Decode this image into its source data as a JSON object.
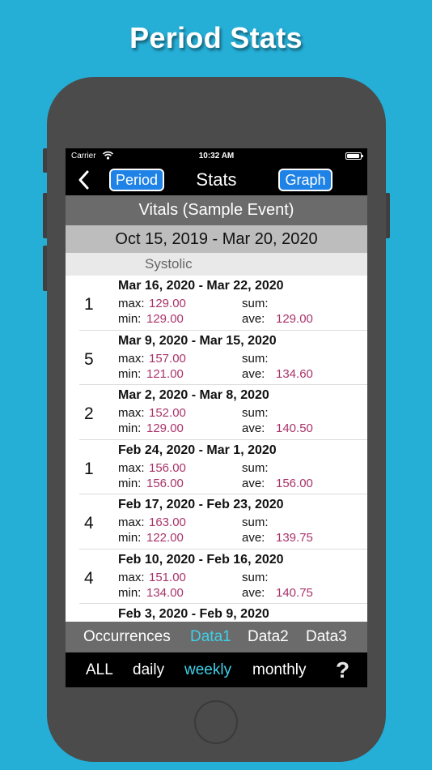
{
  "promo": {
    "title": "Period Stats"
  },
  "status_bar": {
    "carrier": "Carrier",
    "time": "10:32 AM"
  },
  "nav": {
    "period_label": "Period",
    "title": "Stats",
    "graph_label": "Graph"
  },
  "event_title": "Vitals (Sample Event)",
  "date_range": "Oct 15, 2019 - Mar 20, 2020",
  "section": "Systolic",
  "field_labels": {
    "max": "max:",
    "min": "min:",
    "sum": "sum:",
    "ave": "ave:"
  },
  "rows": [
    {
      "count": "1",
      "range": "Mar 16, 2020 - Mar 22, 2020",
      "max": "129.00",
      "min": "129.00",
      "ave": "129.00"
    },
    {
      "count": "5",
      "range": "Mar 9, 2020 - Mar 15, 2020",
      "max": "157.00",
      "min": "121.00",
      "ave": "134.60"
    },
    {
      "count": "2",
      "range": "Mar 2, 2020 - Mar 8, 2020",
      "max": "152.00",
      "min": "129.00",
      "ave": "140.50"
    },
    {
      "count": "1",
      "range": "Feb 24, 2020 - Mar 1, 2020",
      "max": "156.00",
      "min": "156.00",
      "ave": "156.00"
    },
    {
      "count": "4",
      "range": "Feb 17, 2020 - Feb 23, 2020",
      "max": "163.00",
      "min": "122.00",
      "ave": "139.75"
    },
    {
      "count": "4",
      "range": "Feb 10, 2020 - Feb 16, 2020",
      "max": "151.00",
      "min": "134.00",
      "ave": "140.75"
    },
    {
      "count": "",
      "range": "Feb 3, 2020 - Feb 9, 2020",
      "max": "",
      "min": "",
      "ave": ""
    }
  ],
  "data_tabs": [
    "Occurrences",
    "Data1",
    "Data2",
    "Data3"
  ],
  "period_tabs": [
    "ALL",
    "daily",
    "weekly",
    "monthly"
  ],
  "help": "?",
  "colors": {
    "background": "#25aed6",
    "value": "#a8336a",
    "active_tab": "#3fd0e8",
    "button": "#1e82e6"
  }
}
